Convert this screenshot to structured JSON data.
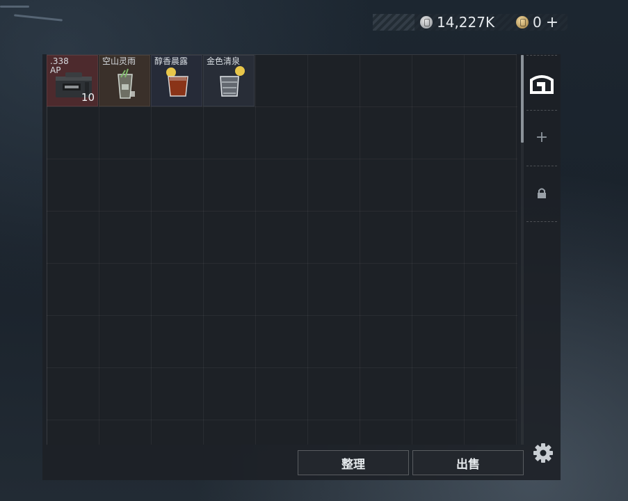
{
  "currency": {
    "silver_amount": "14,227K",
    "gold_amount": "0",
    "add_label": "+"
  },
  "inventory": {
    "items": [
      {
        "name": ".338\nAP",
        "count": "10",
        "icon": "ammo-box-icon",
        "rarity_color": "#4d2a2d"
      },
      {
        "name": "空山灵雨",
        "icon": "mojito-drink-icon",
        "rarity_color": "#3a302a"
      },
      {
        "name": "醇香晨露",
        "icon": "amber-drink-icon",
        "rarity_color": "#262b38"
      },
      {
        "name": "金色清泉",
        "icon": "whiskey-drink-icon",
        "rarity_color": "#282d37"
      }
    ]
  },
  "side_tabs": [
    {
      "icon": "storage-tab-icon",
      "active": true
    },
    {
      "icon": "plus-icon",
      "label": "+"
    },
    {
      "icon": "lock-icon"
    }
  ],
  "actions": {
    "sort_label": "整理",
    "sell_label": "出售"
  },
  "settings_icon": "gear-icon"
}
